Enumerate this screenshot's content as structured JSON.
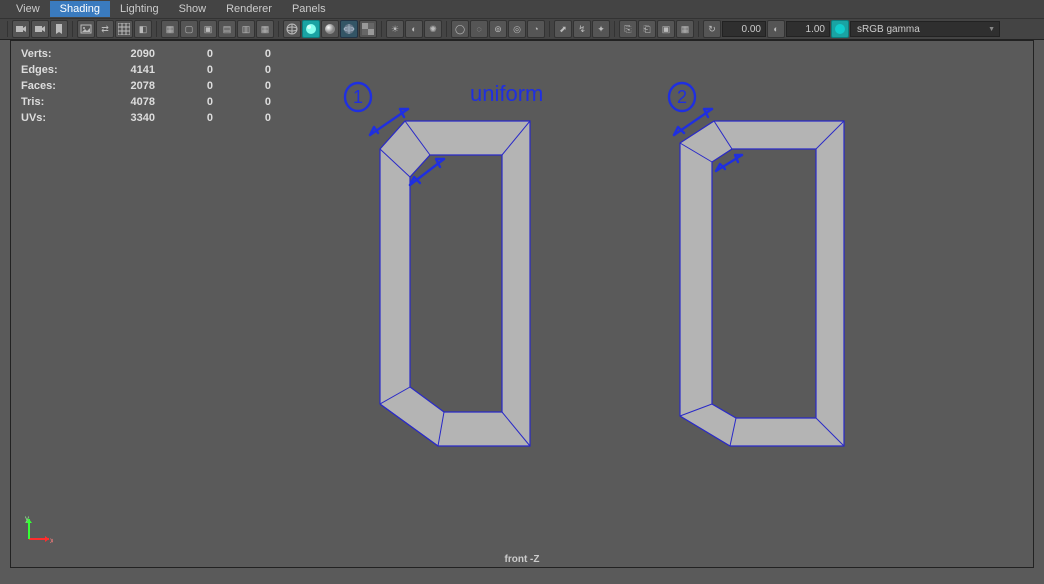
{
  "menus": {
    "view": "View",
    "shading": "Shading",
    "lighting": "Lighting",
    "show": "Show",
    "renderer": "Renderer",
    "panels": "Panels",
    "active": "shading"
  },
  "toolbar": {
    "num1": "0.00",
    "num2": "1.00",
    "colorspace": "sRGB gamma"
  },
  "hud": {
    "rows": [
      {
        "label": "Verts:",
        "a": "2090",
        "b": "0",
        "c": "0"
      },
      {
        "label": "Edges:",
        "a": "4141",
        "b": "0",
        "c": "0"
      },
      {
        "label": "Faces:",
        "a": "2078",
        "b": "0",
        "c": "0"
      },
      {
        "label": "Tris:",
        "a": "4078",
        "b": "0",
        "c": "0"
      },
      {
        "label": "UVs:",
        "a": "3340",
        "b": "0",
        "c": "0"
      }
    ]
  },
  "annotations": {
    "one": "1",
    "two": "2",
    "uniform": "uniform"
  },
  "viewlabel": "front -Z",
  "axis": {
    "x": "x",
    "y": "y"
  }
}
